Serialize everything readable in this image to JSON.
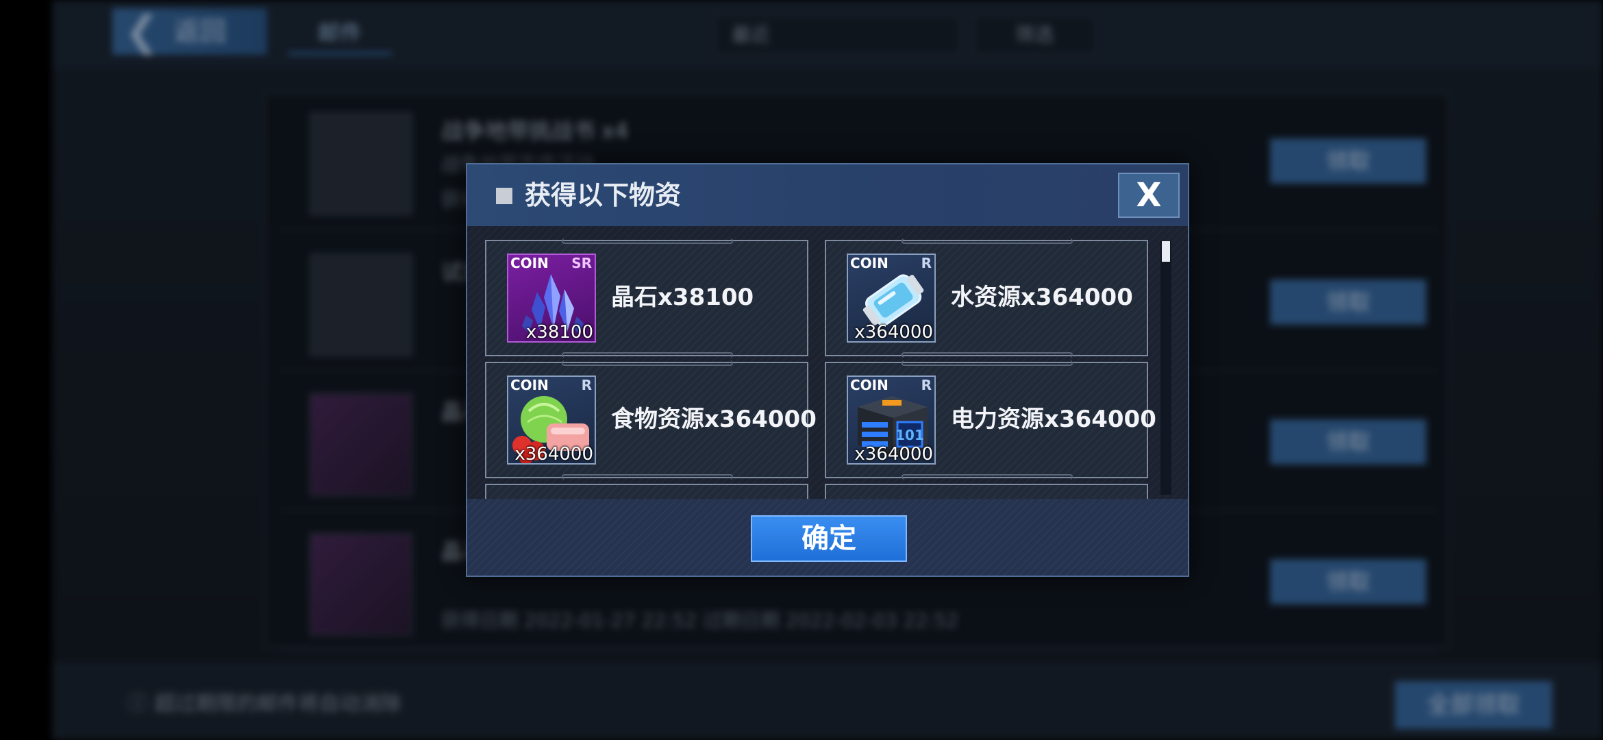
{
  "background": {
    "back_label": "返回",
    "mail_tab": "邮件",
    "sort_label": "最近",
    "filter_label": "筛选",
    "rows": [
      {
        "title": "战争地带挑战书 x4",
        "sub": "战争地带宣传活动",
        "dates": "获得日期",
        "claim": "领取"
      },
      {
        "title": "试炼",
        "sub": "",
        "dates": "",
        "claim": "领取"
      },
      {
        "title": "晶石",
        "sub": "",
        "dates": "",
        "claim": "领取"
      },
      {
        "title": "晶石",
        "sub": "",
        "dates": "获得日期 2022-01-27 22:52  过期日期 2022-02-03 22:52",
        "claim": "领取"
      }
    ],
    "footer_note": "超过期限的邮件将自动消除",
    "claim_all": "全部领取"
  },
  "modal": {
    "title": "获得以下物资",
    "close_symbol": "X",
    "confirm_label": "确定",
    "items": [
      {
        "name": "晶石x38100",
        "coin": "COIN",
        "rarity": "SR",
        "qty": "x38100",
        "icon": "crystal-icon"
      },
      {
        "name": "水资源x364000",
        "coin": "COIN",
        "rarity": "R",
        "qty": "x364000",
        "icon": "water-canister-icon"
      },
      {
        "name": "食物资源x364000",
        "coin": "COIN",
        "rarity": "R",
        "qty": "x364000",
        "icon": "food-icon"
      },
      {
        "name": "电力资源x364000",
        "coin": "COIN",
        "rarity": "R",
        "qty": "x364000",
        "icon": "power-battery-icon"
      }
    ]
  },
  "colors": {
    "confirm_button": "#2a82e8",
    "header_bar": "#2c4a74",
    "sr_rarity": "#7b1fa2",
    "r_rarity": "#2a3f66"
  }
}
